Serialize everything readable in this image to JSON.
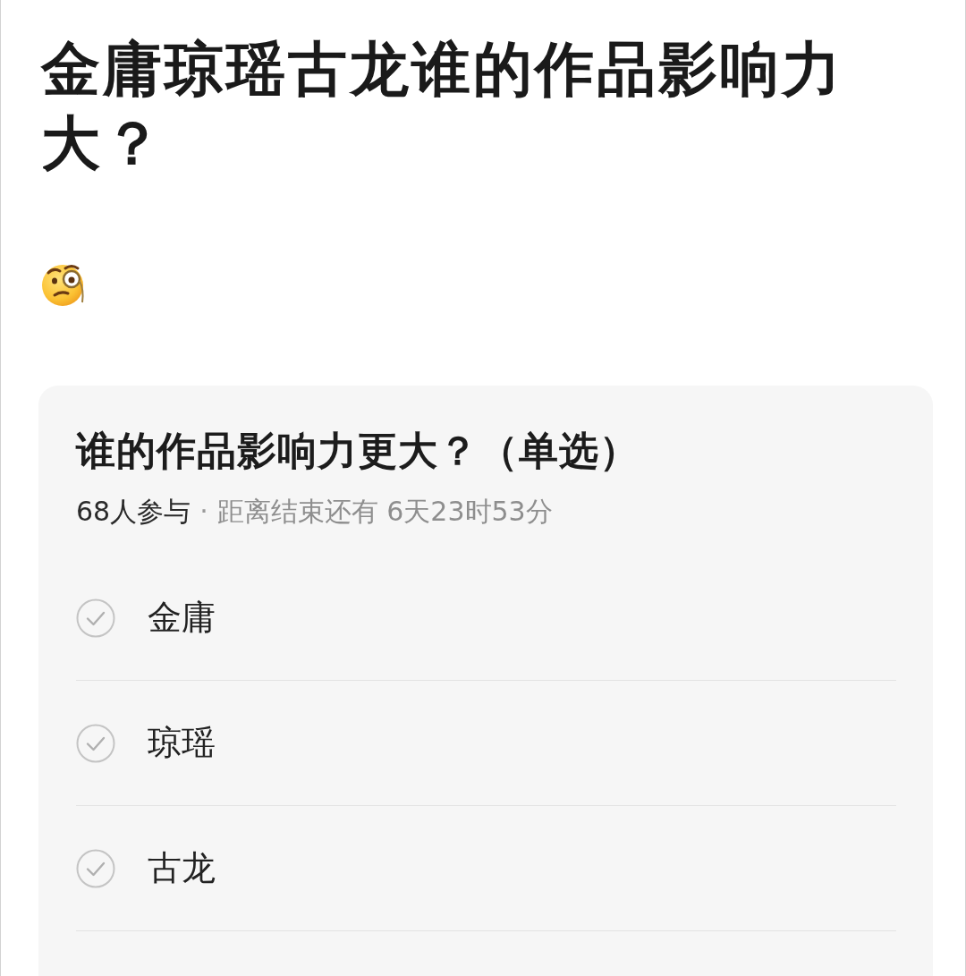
{
  "post": {
    "title": "金庸琼瑶古龙谁的作品影响力大？"
  },
  "poll": {
    "question": "谁的作品影响力更大？（单选）",
    "participants": "68人参与",
    "separator": "·",
    "time_left": "距离结束还有 6天23时53分",
    "options": [
      {
        "label": "金庸",
        "selected": false
      },
      {
        "label": "琼瑶",
        "selected": false
      },
      {
        "label": "古龙",
        "selected": false
      }
    ]
  }
}
